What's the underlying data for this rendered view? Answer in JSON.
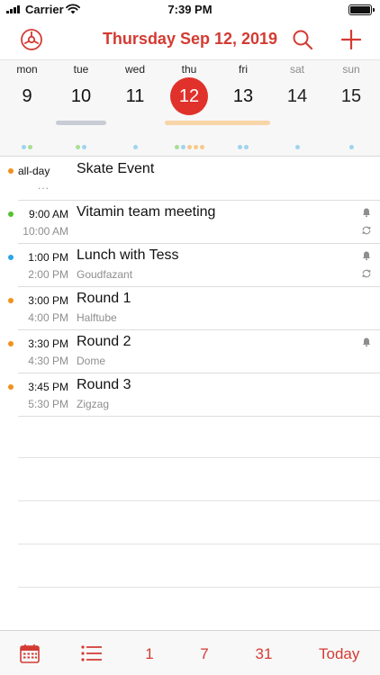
{
  "status_bar": {
    "carrier": "Carrier",
    "time": "7:39 PM"
  },
  "nav": {
    "title": "Thursday Sep 12, 2019",
    "icons": {
      "settings": "gear-icon",
      "search": "search-icon",
      "add": "plus-icon"
    },
    "accent_color": "#d33b33"
  },
  "week": {
    "days": [
      {
        "name": "mon",
        "num": "9"
      },
      {
        "name": "tue",
        "num": "10"
      },
      {
        "name": "wed",
        "num": "11"
      },
      {
        "name": "thu",
        "num": "12"
      },
      {
        "name": "fri",
        "num": "13"
      },
      {
        "name": "sat",
        "num": "14"
      },
      {
        "name": "sun",
        "num": "15"
      }
    ],
    "today_color": "#e0312b"
  },
  "events": {
    "allday": {
      "label": "all-day",
      "title": "Skate Event",
      "more": "..."
    },
    "items": [
      {
        "start": "9:00 AM",
        "end": "10:00 AM",
        "title": "Vitamin team meeting",
        "location": "",
        "color": "#52c22e"
      },
      {
        "start": "1:00 PM",
        "end": "2:00 PM",
        "title": "Lunch with Tess",
        "location": "Goudfazant",
        "color": "#2aa6ea"
      },
      {
        "start": "3:00 PM",
        "end": "4:00 PM",
        "title": "Round 1",
        "location": "Halftube",
        "color": "#f2911b"
      },
      {
        "start": "3:30 PM",
        "end": "4:30 PM",
        "title": "Round 2",
        "location": "Dome",
        "color": "#f2911b"
      },
      {
        "start": "3:45 PM",
        "end": "5:30 PM",
        "title": "Round 3",
        "location": "Zigzag",
        "color": "#f2911b"
      }
    ]
  },
  "toolbar": {
    "day": "1",
    "week": "7",
    "month": "31",
    "today": "Today",
    "icons": {
      "calendar": "calendar-icon",
      "list": "list-icon"
    }
  }
}
